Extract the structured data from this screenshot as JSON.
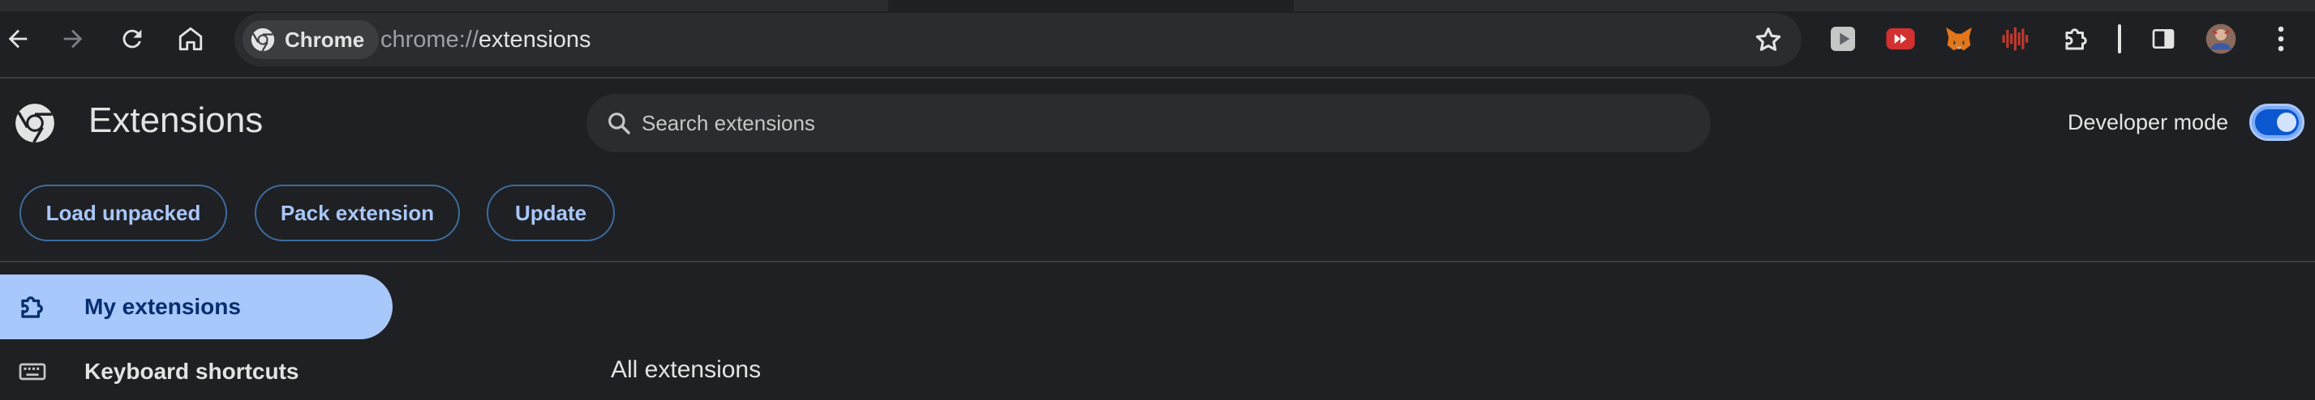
{
  "browser": {
    "omnibox": {
      "chip_label": "Chrome",
      "url_scheme": "chrome://",
      "url_host": "extensions"
    },
    "toolbar_icons": [
      "back-icon",
      "forward-icon",
      "reload-icon",
      "home-icon",
      "bookmark-star-icon"
    ],
    "extension_icons": [
      "play-extension-icon",
      "youtube-speed-extension-icon",
      "metamask-fox-icon",
      "audio-wave-extension-icon",
      "extensions-puzzle-icon",
      "side-panel-icon",
      "profile-avatar",
      "more-menu-icon"
    ]
  },
  "header": {
    "title": "Extensions",
    "search_placeholder": "Search extensions",
    "developer_mode_label": "Developer mode",
    "developer_mode_on": true
  },
  "actions": {
    "load_unpacked": "Load unpacked",
    "pack_extension": "Pack extension",
    "update": "Update"
  },
  "sidebar": {
    "items": [
      {
        "label": "My extensions",
        "icon": "puzzle-icon",
        "selected": true
      },
      {
        "label": "Keyboard shortcuts",
        "icon": "keyboard-icon",
        "selected": false
      }
    ]
  },
  "main": {
    "section_title": "All extensions"
  },
  "colors": {
    "background": "#1f2023",
    "accent": "#a8c7fa",
    "omnibox_bg": "#2b2c2f"
  }
}
